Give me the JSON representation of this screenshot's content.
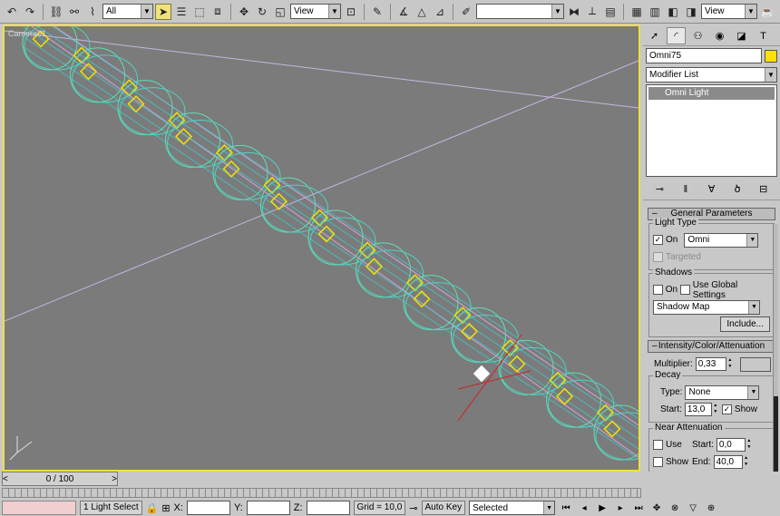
{
  "toolbar": {
    "selection_filter": "All",
    "ref_coord": "View",
    "named_selection": "",
    "view_dropdown": "View"
  },
  "viewport": {
    "label": "Camera01"
  },
  "panel": {
    "object_name": "Omni75",
    "object_color": "#ffe000",
    "modifier_list": "Modifier List",
    "stack_item": "Omni Light",
    "general": {
      "title": "General Parameters",
      "light_type_title": "Light Type",
      "on_label": "On",
      "on_checked": "✓",
      "type_value": "Omni",
      "targeted_label": "Targeted",
      "shadows_title": "Shadows",
      "shadows_on_label": "On",
      "global_label": "Use Global Settings",
      "shadow_type": "Shadow Map",
      "include_label": "Include..."
    },
    "intensity": {
      "title": "Intensity/Color/Attenuation",
      "multiplier_label": "Multiplier:",
      "multiplier_value": "0,33",
      "light_color": "#b8f0fb",
      "decay_title": "Decay",
      "type_label": "Type:",
      "type_value": "None",
      "start_label": "Start:",
      "start_value": "13,0",
      "show_label": "Show",
      "show_checked": "✓"
    },
    "near": {
      "title": "Near Attenuation",
      "use_label": "Use",
      "start_label": "Start:",
      "start_value": "0,0",
      "show_label": "Show",
      "end_label": "End:",
      "end_value": "40,0"
    }
  },
  "bottom": {
    "time_label": "0 / 100",
    "selection_status": "1 Light Select",
    "x_label": "X:",
    "y_label": "Y:",
    "z_label": "Z:",
    "grid": "Grid = 10,0",
    "auto_key": "Auto Key",
    "key_mode": "Selected"
  }
}
